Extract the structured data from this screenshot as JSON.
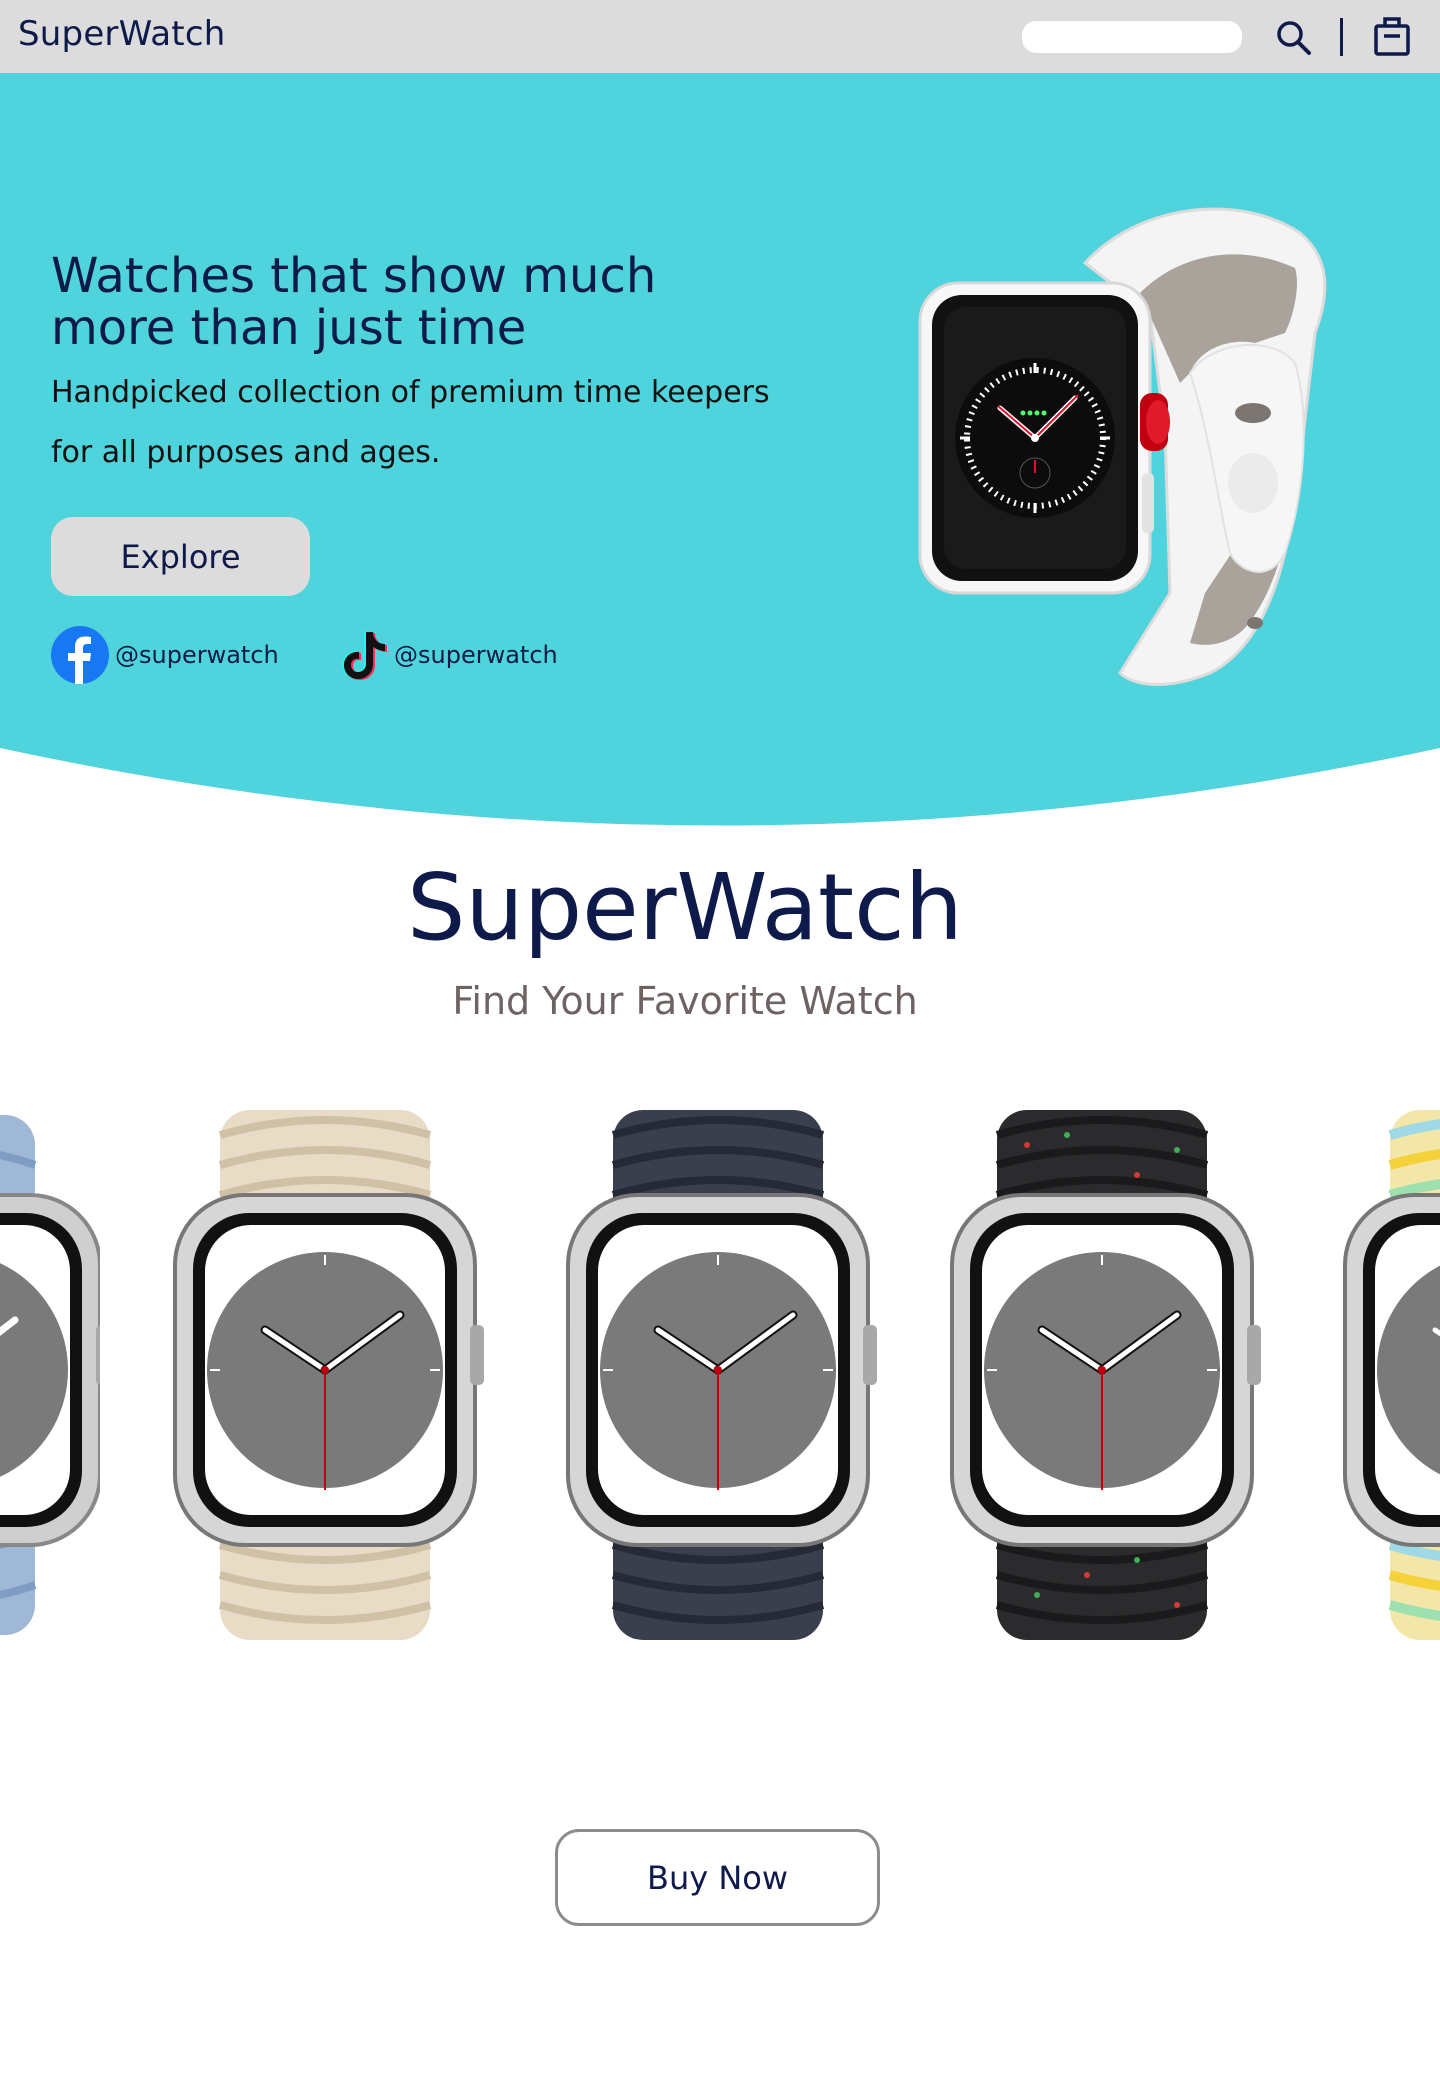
{
  "header": {
    "brand": "SuperWatch",
    "search_placeholder": "",
    "icons": [
      "search-icon",
      "shopping-bag-icon"
    ],
    "background_color": "#dcdcdc"
  },
  "hero": {
    "title_line1": "Watches that show much",
    "title_line2": "more than just time",
    "subtitle_line1": "Handpicked collection of premium time keepers",
    "subtitle_line2": "for all purposes and ages.",
    "explore_label": "Explore",
    "background_color": "#4fd3dc",
    "socials": [
      {
        "network": "facebook",
        "icon": "facebook-icon",
        "handle": "@superwatch"
      },
      {
        "network": "tiktok",
        "icon": "tiktok-icon",
        "handle": "@superwatch"
      }
    ]
  },
  "section": {
    "title": "SuperWatch",
    "tagline": "Find Your Favorite Watch"
  },
  "carousel": {
    "watches": [
      {
        "band_color": "#9fb8d6",
        "pattern": "#7f9cc2"
      },
      {
        "band_color": "#e8dcc7",
        "pattern": "#cfc0a6"
      },
      {
        "band_color": "#3a3f4e",
        "pattern": "#262a36"
      },
      {
        "band_color": "#2b2a2c",
        "pattern": "#1a191b"
      },
      {
        "band_color": "#f2e6a8",
        "pattern": "#9fd8e6"
      }
    ]
  },
  "cta": {
    "buy_label": "Buy Now"
  }
}
